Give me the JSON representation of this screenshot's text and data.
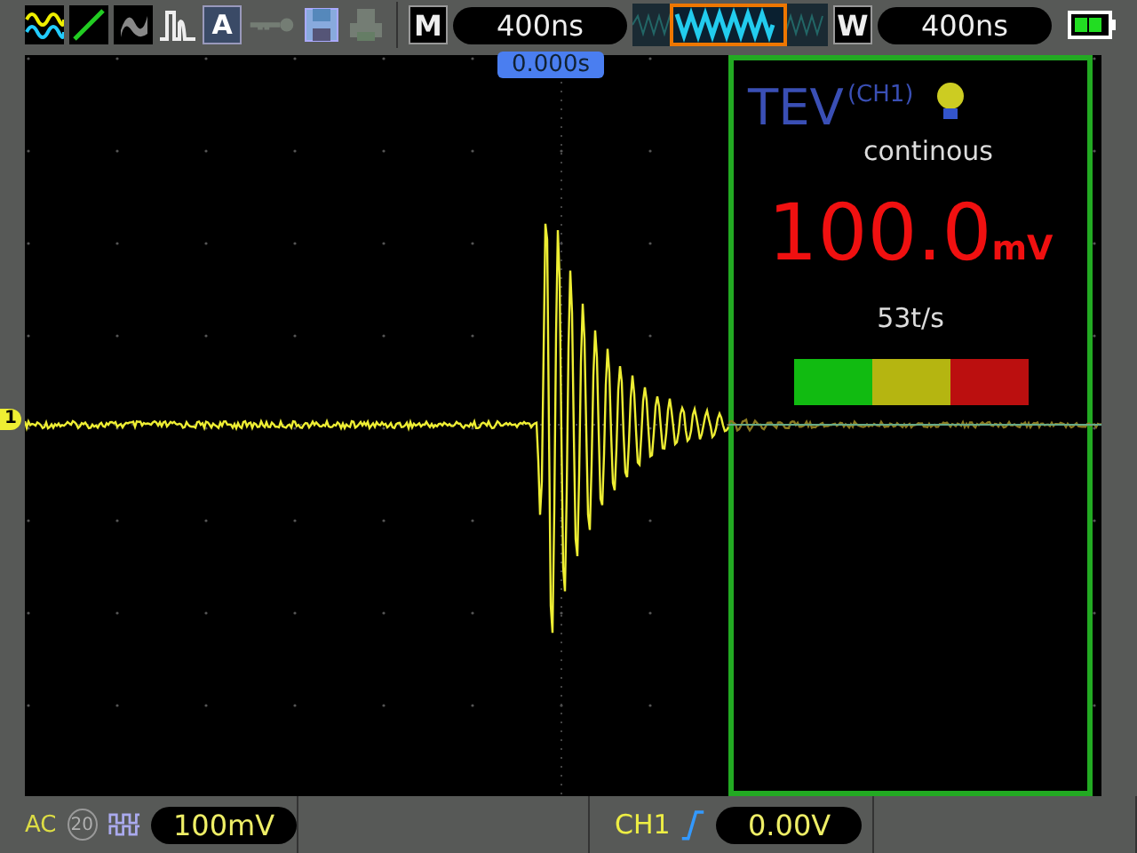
{
  "toolbar": [
    {
      "kind": "wave",
      "disabled": false
    },
    {
      "kind": "line",
      "disabled": false
    },
    {
      "kind": "persist",
      "disabled": false
    },
    {
      "kind": "pulse",
      "disabled": false
    },
    {
      "kind": "auto",
      "label": "A",
      "disabled": false
    },
    {
      "kind": "key",
      "disabled": true
    },
    {
      "kind": "save",
      "disabled": false
    },
    {
      "kind": "print",
      "disabled": true
    }
  ],
  "timebase": {
    "label": "M",
    "value": "400ns"
  },
  "window": {
    "label": "W",
    "value": "400ns"
  },
  "trigger_position": "0.000s",
  "channel_marker": "1",
  "panel": {
    "title": "TEV",
    "channel": "(CH1)",
    "mode": "continous",
    "value": "100.0",
    "unit": "mV",
    "rate": "53t/s",
    "levels": [
      {
        "color": "#11bb11"
      },
      {
        "color": "#b5b511"
      },
      {
        "color": "#bb0f0f"
      }
    ]
  },
  "status": {
    "coupling": "AC",
    "bw_limit": {
      "label": "20",
      "on": false
    },
    "scale": "100mV",
    "trigger_source": "CH1",
    "trigger_level": "0.00V"
  }
}
